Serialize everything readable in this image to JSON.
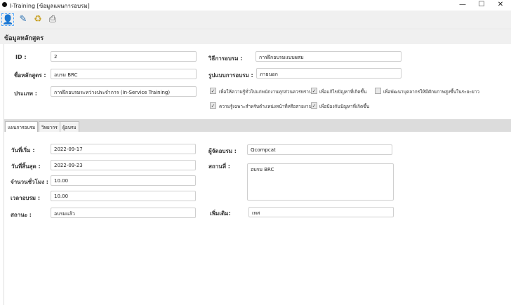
{
  "window": {
    "title": "I-Training [ข้อมูลแผนการอบรม]",
    "minimize": "—",
    "maximize": "☐",
    "close": "✕"
  },
  "toolbar": {
    "icons": [
      "user-icon",
      "edit-icon",
      "recycle-bin-icon",
      "printer-icon"
    ]
  },
  "section": {
    "title": "ข้อมูลหลักสูตร"
  },
  "course": {
    "id_label": "ID :",
    "id_value": "2",
    "name_label": "ชื่อหลักสูตร :",
    "name_value": "อบรม BRC",
    "type_label": "ประเภท :",
    "type_value": "การฝึกอบรมระหว่างประจำการ (In-Service Training)",
    "method_label": "วิธีการอบรม :",
    "method_value": "การฝึกอบรมแบบผสม",
    "format_label": "รูปแบบการอบรม :",
    "format_value": "ภายนอก",
    "objectives": [
      {
        "label": "เพื่อให้ความรู้ทั่วไปแก่พนักงานทุกส่วนควรทราบ",
        "checked": true
      },
      {
        "label": "เพื่อแก้ไขปัญหาที่เกิดขึ้น",
        "checked": true
      },
      {
        "label": "เพื่อพัฒนาบุคลากรให้มีศักยภาพสูงขึ้นในระยะยาว",
        "checked": false
      },
      {
        "label": "ความรู้เฉพาะสำหรับตำแหน่งหน้าที่หรือสายงาน",
        "checked": true
      },
      {
        "label": "เพื่อป้องกันปัญหาที่เกิดขึ้น",
        "checked": true
      }
    ]
  },
  "tabs": [
    {
      "label": "แผนการอบรม",
      "active": true
    },
    {
      "label": "วิทยากร"
    },
    {
      "label": "ผู้อบรม"
    }
  ],
  "plan": {
    "start_label": "วันที่เริ่ม  :",
    "start_value": "2022-09-17",
    "end_label": "วันที่สิ้นสุด  :",
    "end_value": "2022-09-23",
    "hours_label": "จำนวนชั่วโมง :",
    "hours_value": "10.00",
    "time_label": "เวลาอบรม :",
    "time_value": "10.00",
    "status_label": "สถานะ :",
    "status_value": "อบรมแล้ว",
    "organizer_label": "ผู้จัดอบรม :",
    "organizer_value": "Qcompcat",
    "place_label": "สถานที่ :",
    "place_value": "อบรม BRC",
    "extra_label": "เพิ่มเติม:",
    "extra_value": "เทส"
  }
}
